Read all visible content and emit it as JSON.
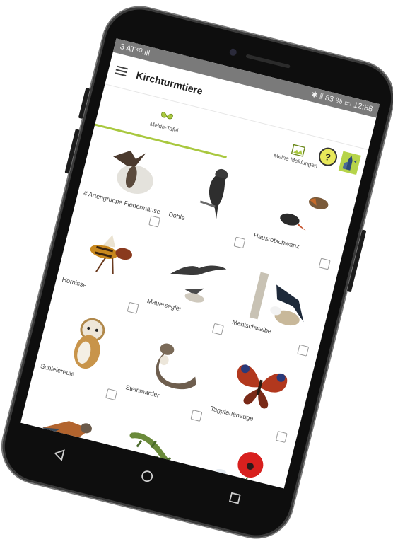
{
  "statusbar": {
    "left": "3 AT⁴ᴳ.ıll",
    "right": "✱ ⦀ 83 % ▭ 12:58"
  },
  "app": {
    "title": "Kirchturmtiere"
  },
  "tabs": [
    {
      "label": "Melde-Tafel",
      "icon": "butterfly-icon"
    },
    {
      "label": "Meine Meldungen",
      "icon": "gallery-icon"
    }
  ],
  "actions": {
    "help_symbol": "?"
  },
  "species": [
    {
      "label": "# Artengruppe Fledermäuse",
      "icon": "bat"
    },
    {
      "label": "Dohle",
      "icon": "jackdaw"
    },
    {
      "label": "Hausrotschwanz",
      "icon": "redstart"
    },
    {
      "label": "Hornisse",
      "icon": "hornet"
    },
    {
      "label": "Mauersegler",
      "icon": "swift"
    },
    {
      "label": "Mehlschwalbe",
      "icon": "house-martin"
    },
    {
      "label": "Schleiereule",
      "icon": "barn-owl"
    },
    {
      "label": "Steinmarder",
      "icon": "stone-marten"
    },
    {
      "label": "Tagpfauenauge",
      "icon": "peacock-butterfly"
    },
    {
      "label": "",
      "icon": "kestrel"
    },
    {
      "label": "",
      "icon": "lizard"
    },
    {
      "label": "",
      "icon": "poppy-bee"
    }
  ],
  "colors": {
    "accent": "#a9c83f",
    "statusbar": "#7a7a7a",
    "phone": "#0e0e0e"
  }
}
